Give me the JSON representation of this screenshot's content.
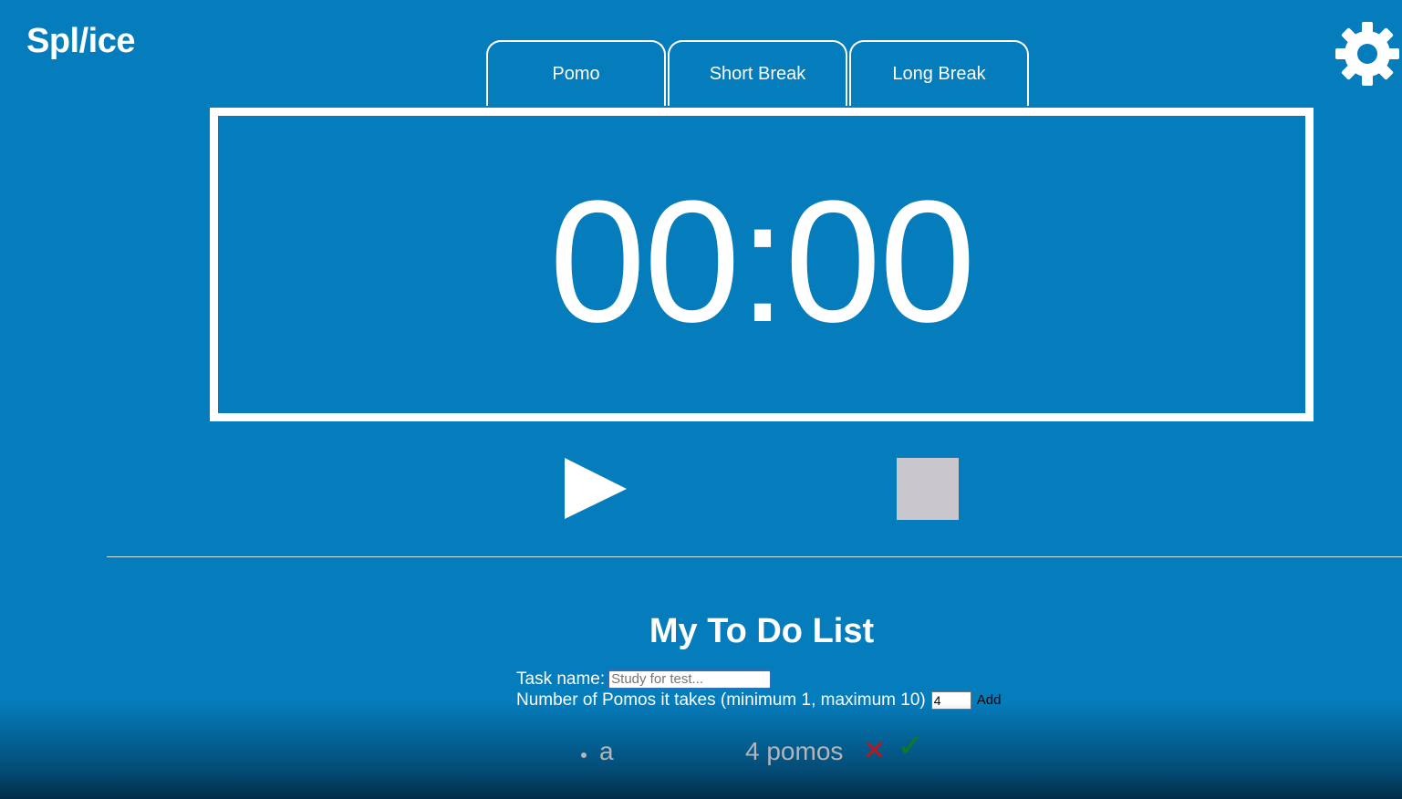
{
  "app": {
    "logo": "Spl/ice"
  },
  "header": {
    "settings_icon": "gear-icon"
  },
  "tabs": [
    {
      "label": "Pomo"
    },
    {
      "label": "Short Break"
    },
    {
      "label": "Long Break"
    }
  ],
  "timer": {
    "display": "00:00"
  },
  "controls": {
    "play_icon": "play-icon",
    "stop_icon": "stop-icon"
  },
  "todo": {
    "title": "My To Do List",
    "task_name_label": "Task name:",
    "task_name_placeholder": "Study for test...",
    "task_name_value": "",
    "pomos_label": "Number of Pomos it takes (minimum 1, maximum 10)",
    "pomos_value": "4",
    "add_label": "Add",
    "items": [
      {
        "name": "a",
        "pomos": "4 pomos",
        "delete_glyph": "✕",
        "complete_glyph": "✓"
      }
    ]
  },
  "colors": {
    "background": "#057cbb",
    "stop_button": "#c9c7cb",
    "delete": "#c0161a",
    "complete": "#107c1c"
  }
}
